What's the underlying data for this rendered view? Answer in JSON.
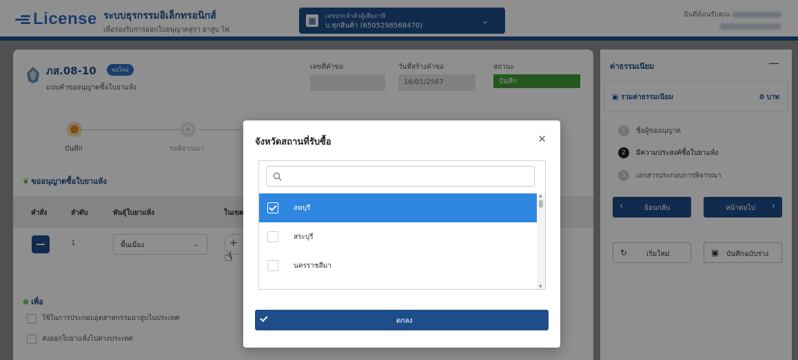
{
  "header": {
    "logo_text": "License",
    "system_title": "ระบบธุรกรรมอิเล็กทรอนิกส์",
    "system_subtitle": "เพื่อรองรับการออกใบอนุญาตสุรา ยาสูบ ไพ่",
    "taxpayer_label": "เลขประจำตัวผู้เสียภาษี",
    "taxpayer_value": "บ.ทุกสินค้า (6505298568470)",
    "welcome": "ยินดีต้อนรับคุณ"
  },
  "form": {
    "code": "ภส.08-10",
    "badge": "ขอใหม่",
    "name": "แบบคำขออนุญาตซื้อใบยาแห้ง",
    "request_no_label": "เลขที่คำขอ",
    "request_no_value": "",
    "created_label": "วันที่สร้างคำขอ",
    "created_value": "16/01/2567",
    "status_label": "สถานะ",
    "status_value": "บันทึก"
  },
  "progress": {
    "steps": [
      {
        "label": "บันทึก"
      },
      {
        "label": "รอพิจารณา"
      }
    ]
  },
  "section": {
    "title": "ขออนุญาตซื้อใบยาแห้ง",
    "headers": [
      "คำสั่ง",
      "ลำดับ",
      "พันธุ์ใบยาแห้ง",
      "ในเขต"
    ],
    "row": {
      "no": "1",
      "variety": "พื้นเมือง",
      "add_label": "+ เ"
    }
  },
  "purpose": {
    "title": "เพื่อ",
    "options": [
      "ใช้ในการประกอบอุตสาหกรรมยาสูบในประเทศ",
      "ส่งออกใบยาแห้งไปต่างประเทศ"
    ]
  },
  "sidebar": {
    "fee_title": "ค่าธรรมเนียม",
    "fee_total_label": "รวมค่าธรรมเนียม",
    "fee_total_value": "0 บาท",
    "steps": [
      {
        "num": "1",
        "label": "ชื่อผู้ขออนุญาต"
      },
      {
        "num": "2",
        "label": "มีความประสงค์ซื้อใบยาแห้ง"
      },
      {
        "num": "3",
        "label": "เอกสารประกอบการพิจารณา"
      }
    ],
    "back_label": "ย้อนกลับ",
    "next_label": "หน้าต่อไป",
    "restart_label": "เริ่มใหม่",
    "save_draft_label": "บันทึกฉบับร่าง"
  },
  "modal": {
    "title": "จังหวัดสถานที่รับซื้อ",
    "search_placeholder": "",
    "options": [
      {
        "label": "ลพบุรี",
        "checked": true
      },
      {
        "label": "สระบุรี",
        "checked": false
      },
      {
        "label": "นครราชสีมา",
        "checked": false
      }
    ],
    "ok_label": "ตกลง"
  },
  "colors": {
    "primary": "#1d4e89",
    "accent": "#2f86e0",
    "status_green": "#3f9c35",
    "step_active": "#e08a16"
  }
}
